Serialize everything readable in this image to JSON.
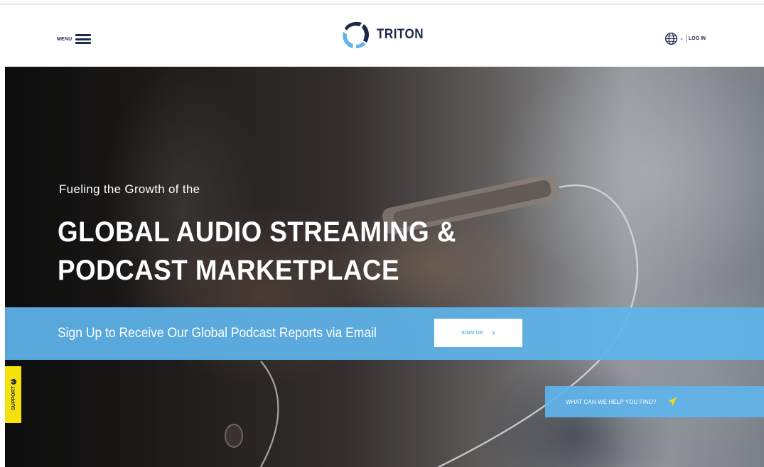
{
  "header": {
    "menu_label": "MENU",
    "logo_text": "TRITON",
    "login_label": "LOG IN",
    "globe_dropdown": "⌄"
  },
  "hero": {
    "subtitle": "Fueling the Growth of the",
    "title_line1": "GLOBAL AUDIO STREAMING &",
    "title_line2": "PODCAST MARKETPLACE",
    "signup_text": "Sign Up to Receive Our Global Podcast Reports via Email",
    "signup_button": "SIGN UP",
    "signup_chevron": "›",
    "help_text": "WHAT CAN WE HELP YOU FIND?"
  },
  "support": {
    "label": "SUPPORT",
    "icon_glyph": "?"
  },
  "colors": {
    "accent_blue": "#5fb4eb",
    "navy": "#1e2a4a",
    "support_yellow": "#f5e20a",
    "send_icon_yellow": "#f5d90a"
  },
  "icons": [
    "hamburger-icon",
    "triton-logo-icon",
    "globe-icon",
    "chevron-down-icon",
    "chevron-right-icon",
    "send-icon",
    "question-icon"
  ]
}
